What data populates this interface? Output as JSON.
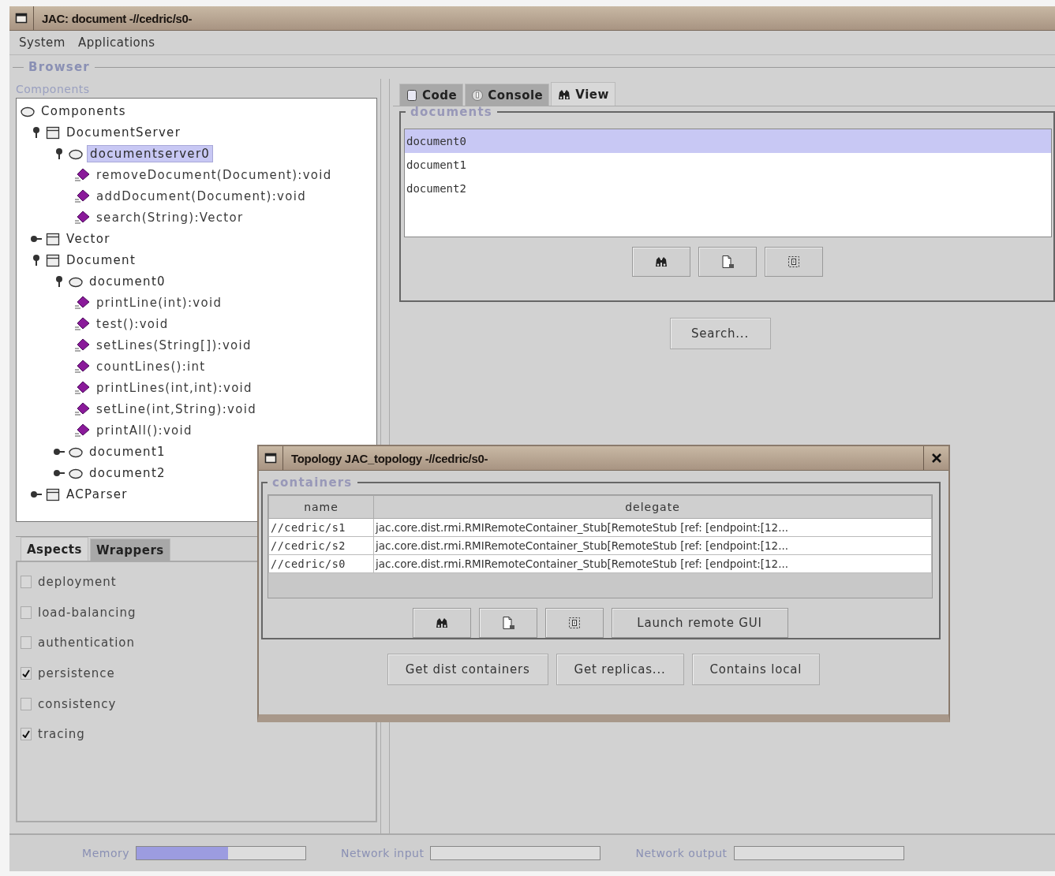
{
  "window": {
    "title": "JAC: document -//cedric/s0-"
  },
  "menu": [
    {
      "label": "System"
    },
    {
      "label": "Applications"
    }
  ],
  "browser": {
    "title": "Browser",
    "components_label": "Components",
    "tree": {
      "label": "Components",
      "kind": "root",
      "selected": false,
      "children": [
        {
          "label": "DocumentServer",
          "kind": "class",
          "expanded": true,
          "selected": false,
          "children": [
            {
              "label": "documentserver0",
              "kind": "object",
              "expanded": true,
              "selected": true,
              "children": [
                {
                  "label": "removeDocument(Document):void",
                  "kind": "method",
                  "selected": false
                },
                {
                  "label": "addDocument(Document):void",
                  "kind": "method",
                  "selected": false
                },
                {
                  "label": "search(String):Vector",
                  "kind": "method",
                  "selected": false
                }
              ]
            }
          ]
        },
        {
          "label": "Vector",
          "kind": "class",
          "expanded": false,
          "selected": false
        },
        {
          "label": "Document",
          "kind": "class",
          "expanded": true,
          "selected": false,
          "children": [
            {
              "label": "document0",
              "kind": "object",
              "expanded": true,
              "selected": false,
              "children": [
                {
                  "label": "printLine(int):void",
                  "kind": "method",
                  "selected": false
                },
                {
                  "label": "test():void",
                  "kind": "method",
                  "selected": false
                },
                {
                  "label": "setLines(String[]):void",
                  "kind": "method",
                  "selected": false
                },
                {
                  "label": "countLines():int",
                  "kind": "method",
                  "selected": false
                },
                {
                  "label": "printLines(int,int):void",
                  "kind": "method",
                  "selected": false
                },
                {
                  "label": "setLine(int,String):void",
                  "kind": "method",
                  "selected": false
                },
                {
                  "label": "printAll():void",
                  "kind": "method",
                  "selected": false
                }
              ]
            },
            {
              "label": "document1",
              "kind": "object",
              "expanded": false,
              "selected": false
            },
            {
              "label": "document2",
              "kind": "object",
              "expanded": false,
              "selected": false
            }
          ]
        },
        {
          "label": "ACParser",
          "kind": "class",
          "expanded": false,
          "selected": false
        }
      ]
    }
  },
  "aspect_tabs": [
    {
      "label": "Aspects",
      "selected": true
    },
    {
      "label": "Wrappers",
      "selected": false
    }
  ],
  "aspects": [
    {
      "label": "deployment",
      "checked": false
    },
    {
      "label": "load-balancing",
      "checked": false
    },
    {
      "label": "authentication",
      "checked": false
    },
    {
      "label": "persistence",
      "checked": true
    },
    {
      "label": "consistency",
      "checked": false
    },
    {
      "label": "tracing",
      "checked": true
    }
  ],
  "view_tabs": [
    {
      "label": "Code",
      "kind": "code",
      "selected": false
    },
    {
      "label": "Console",
      "kind": "console",
      "selected": false
    },
    {
      "label": "View",
      "kind": "view",
      "selected": true
    }
  ],
  "documents": {
    "title": "documents",
    "items": [
      {
        "label": "document0",
        "selected": true
      },
      {
        "label": "document1",
        "selected": false
      },
      {
        "label": "document2",
        "selected": false
      }
    ],
    "icon_buttons": [
      {
        "kind": "view"
      },
      {
        "kind": "new"
      },
      {
        "kind": "select"
      }
    ]
  },
  "search_button": "Search...",
  "topology": {
    "title": "Topology JAC_topology -//cedric/s0-",
    "group_title": "containers",
    "columns": [
      "name",
      "delegate"
    ],
    "rows": [
      [
        "//cedric/s1",
        "jac.core.dist.rmi.RMIRemoteContainer_Stub[RemoteStub [ref: [endpoint:[12..."
      ],
      [
        "//cedric/s2",
        "jac.core.dist.rmi.RMIRemoteContainer_Stub[RemoteStub [ref: [endpoint:[12..."
      ],
      [
        "//cedric/s0",
        "jac.core.dist.rmi.RMIRemoteContainer_Stub[RemoteStub [ref: [endpoint:[12..."
      ]
    ],
    "icon_buttons": [
      {
        "kind": "view"
      },
      {
        "kind": "new"
      },
      {
        "kind": "select"
      }
    ],
    "launch_button": "Launch remote GUI",
    "buttons": [
      "Get dist containers",
      "Get replicas...",
      "Contains local"
    ]
  },
  "status_bar": {
    "meters": [
      {
        "label": "Memory",
        "level": 0.54
      },
      {
        "label": "Network input"
      },
      {
        "label": "Network output"
      }
    ]
  }
}
